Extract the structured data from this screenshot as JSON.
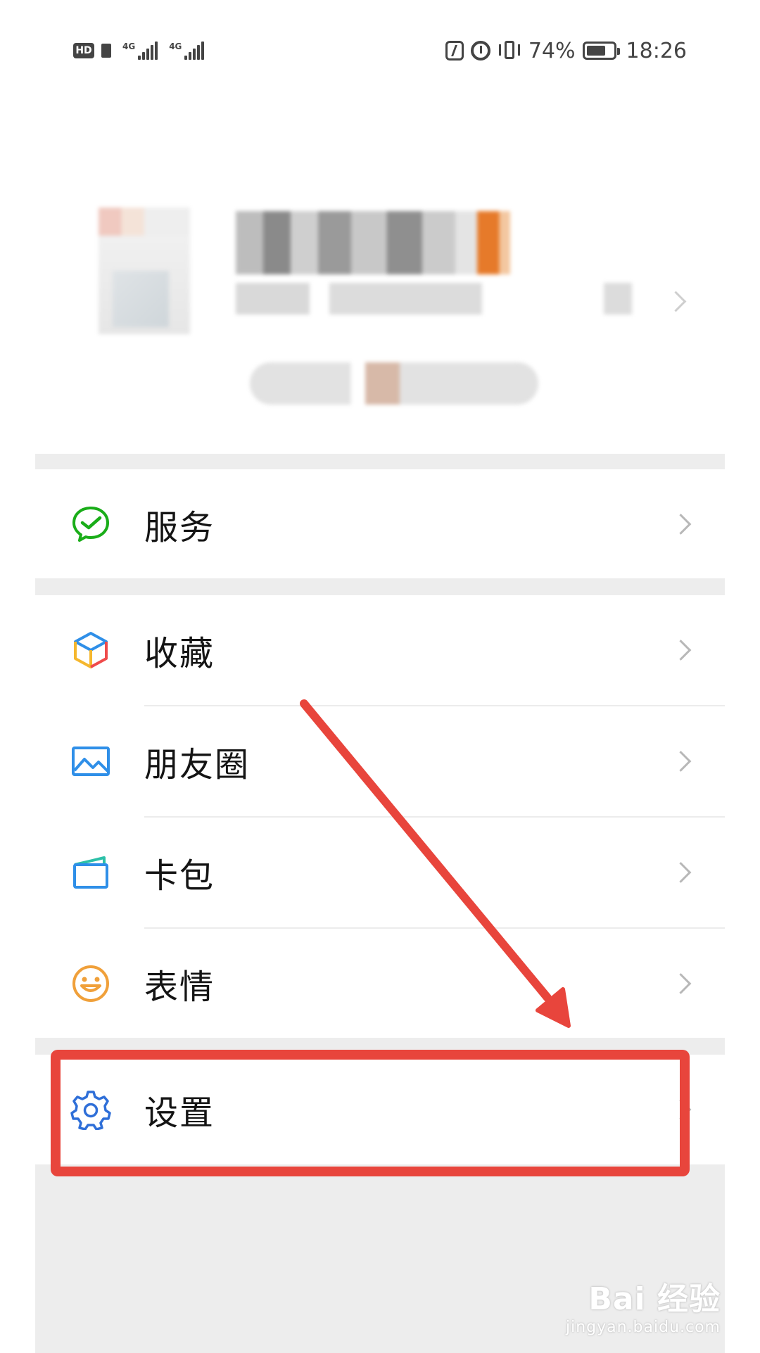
{
  "status_bar": {
    "hd_label": "HD",
    "net1_label": "4G",
    "net2_label": "4G",
    "battery_percent": "74%",
    "battery_level": 0.74,
    "time": "18:26"
  },
  "menu": {
    "services": {
      "label": "服务",
      "icon": "wechat-pay-check-icon",
      "color": "#1aad19"
    },
    "favorites": {
      "label": "收藏",
      "icon": "cube-icon"
    },
    "moments": {
      "label": "朋友圈",
      "icon": "image-icon",
      "color": "#2f8fe8"
    },
    "cards": {
      "label": "卡包",
      "icon": "card-wallet-icon",
      "color": "#2f8fe8"
    },
    "stickers": {
      "label": "表情",
      "icon": "smiley-icon",
      "color": "#f0a03a"
    },
    "settings": {
      "label": "设置",
      "icon": "gear-icon",
      "color": "#2f6fd8"
    }
  },
  "annotation": {
    "color": "#e8453c"
  },
  "watermark": {
    "main": "Bai 经验",
    "sub": "jingyan.baidu.com"
  }
}
